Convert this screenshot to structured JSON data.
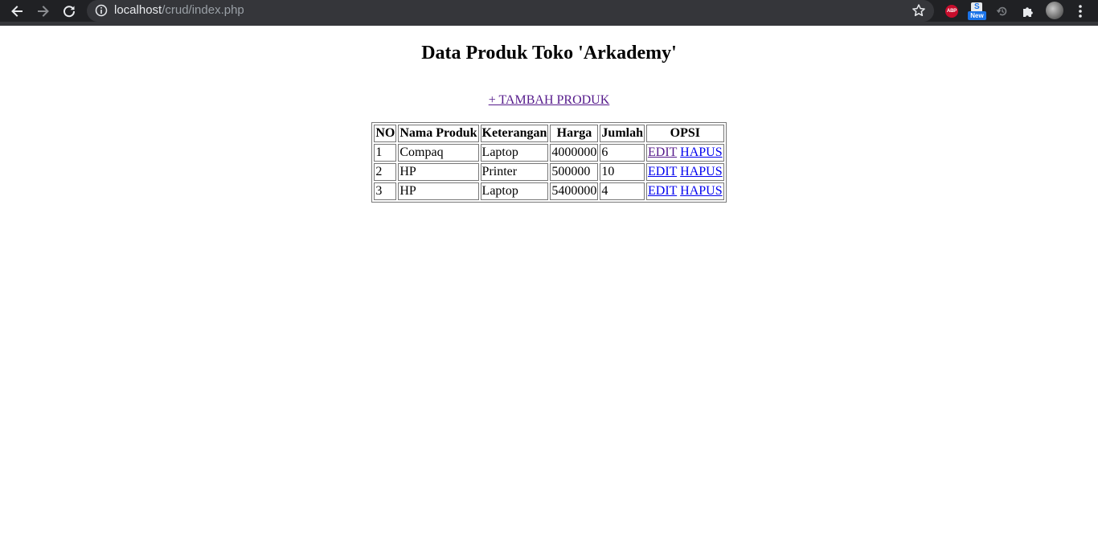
{
  "browser": {
    "url_host": "localhost",
    "url_path": "/crud/index.php",
    "icons": [
      "back-arrow-icon",
      "forward-arrow-icon",
      "reload-icon",
      "info-icon",
      "bookmark-star-icon",
      "adblock-plus-icon",
      "new-extension-icon",
      "history-icon",
      "puzzle-extensions-icon",
      "profile-avatar",
      "kebab-menu-icon"
    ],
    "extensions": {
      "abp_label": "ABP",
      "new_badge": "New",
      "new_icon_letter": "S"
    }
  },
  "page": {
    "title": "Data Produk Toko 'Arkademy'",
    "add_link": "+ TAMBAH PRODUK"
  },
  "table": {
    "headers": [
      "NO",
      "Nama Produk",
      "Keterangan",
      "Harga",
      "Jumlah",
      "OPSI"
    ],
    "rows": [
      {
        "no": "1",
        "nama": "Compaq",
        "keterangan": "Laptop",
        "harga": "4000000",
        "jumlah": "6",
        "edit": "EDIT",
        "hapus": "HAPUS"
      },
      {
        "no": "2",
        "nama": "HP",
        "keterangan": "Printer",
        "harga": "500000",
        "jumlah": "10",
        "edit": "EDIT",
        "hapus": "HAPUS"
      },
      {
        "no": "3",
        "nama": "HP",
        "keterangan": "Laptop",
        "harga": "5400000",
        "jumlah": "4",
        "edit": "EDIT",
        "hapus": "HAPUS"
      }
    ]
  },
  "colors": {
    "toolbar_bg": "#202124",
    "omnibox_bg": "#35363a",
    "link_unvisited": "#0000ee",
    "link_visited": "#551a8b"
  }
}
